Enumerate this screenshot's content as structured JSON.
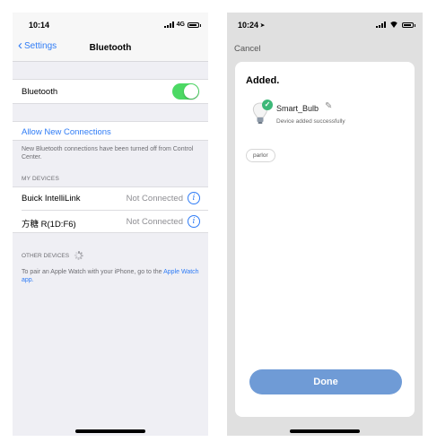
{
  "left_screen": {
    "status_bar": {
      "time": "10:14",
      "network": "4G"
    },
    "nav": {
      "back_label": "Settings",
      "title": "Bluetooth"
    },
    "bluetooth_row": {
      "label": "Bluetooth",
      "toggle_on": true
    },
    "allow_new_connections": "Allow New Connections",
    "allow_note": "New Bluetooth connections have been turned off from Control Center.",
    "my_devices_header": "MY DEVICES",
    "my_devices": [
      {
        "name": "Buick IntelliLink",
        "status": "Not Connected"
      },
      {
        "name": "方糖 R(1D:F6)",
        "status": "Not Connected"
      }
    ],
    "other_devices_header": "OTHER DEVICES",
    "watch_note": "To pair an Apple Watch with your iPhone, go to the",
    "watch_link": "Apple Watch app."
  },
  "right_screen": {
    "status_bar": {
      "time": "10:24"
    },
    "cancel_label": "Cancel",
    "card_title": "Added.",
    "device": {
      "name": "Smart_Bulb",
      "status": "Device added successfully"
    },
    "room_chip": "parlor",
    "done_label": "Done"
  },
  "colors": {
    "ios_blue": "#2f7cf6",
    "toggle_green": "#4cd964",
    "done_button": "#6f9bd6",
    "success_green": "#3cb878"
  },
  "icons": [
    "back-chevron-icon",
    "info-icon",
    "loading-spinner-icon",
    "signal-icon",
    "battery-icon",
    "wifi-icon",
    "location-arrow-icon",
    "bulb-icon",
    "checkmark-icon",
    "pencil-edit-icon"
  ]
}
